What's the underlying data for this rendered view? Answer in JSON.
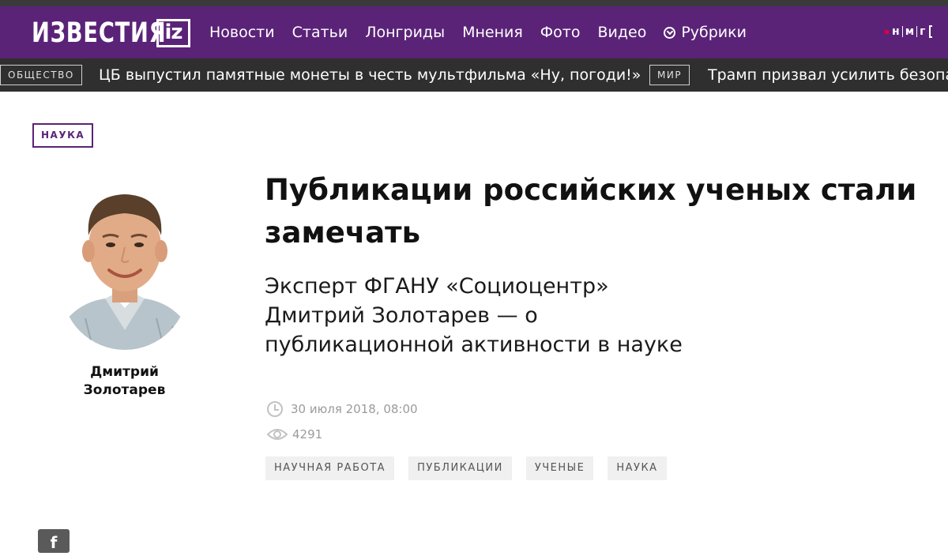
{
  "header": {
    "logo_text": "ИЗВЕСТИЯ",
    "logo_iz": "iz",
    "nav": [
      "Новости",
      "Статьи",
      "Лонгриды",
      "Мнения",
      "Фото",
      "Видео"
    ],
    "rubriki": "Рубрики",
    "network_logo": [
      "н",
      "м",
      "г"
    ]
  },
  "ticker": [
    {
      "tag": "ОБЩЕСТВО",
      "text": "ЦБ выпустил памятные монеты в честь мультфильма «Ну, погоди!»"
    },
    {
      "tag": "МИР",
      "text": "Трамп призвал усилить безопа"
    }
  ],
  "article": {
    "section": "НАУКА",
    "author": "Дмитрий Золотарев",
    "title": "Публикации российских ученых стали замечать",
    "subtitle": "Эксперт ФГАНУ «Социоцентр» Дмитрий Золотарев — о публикационной активности в науке",
    "date": "30 июля 2018, 08:00",
    "views": "4291",
    "tags": [
      "НАУЧНАЯ РАБОТА",
      "ПУБЛИКАЦИИ",
      "УЧЕНЫЕ",
      "НАУКА"
    ]
  },
  "share": {
    "facebook": "f"
  },
  "colors": {
    "brand": "#5a2378",
    "ticker_bg": "#2f2f2f",
    "tag_bg": "#f0f0f0"
  }
}
